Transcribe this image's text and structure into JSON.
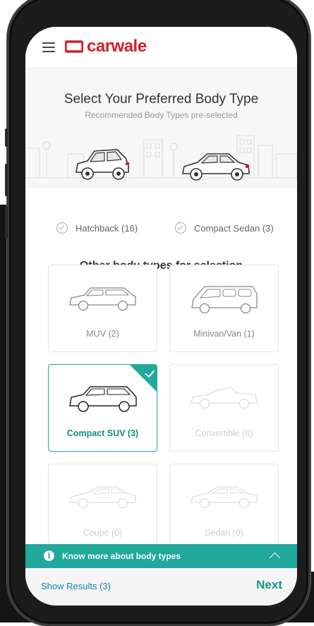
{
  "header": {
    "logo_text": "carwale"
  },
  "hero": {
    "title": "Select Your Preferred Body Type",
    "subtitle": "Recommended Body Types pre-selected"
  },
  "recommended": [
    {
      "label": "Hatchback (16)"
    },
    {
      "label": "Compact Sedan (3)"
    }
  ],
  "other": {
    "title": "Other body types for selection",
    "tiles": [
      {
        "label": "MUV (2)",
        "state": "normal"
      },
      {
        "label": "Minivan/Van (1)",
        "state": "normal"
      },
      {
        "label": "Compact SUV (3)",
        "state": "selected"
      },
      {
        "label": "Convertible (0)",
        "state": "disabled"
      },
      {
        "label": "Coupe (0)",
        "state": "disabled"
      },
      {
        "label": "Sedan (0)",
        "state": "disabled"
      }
    ]
  },
  "info_bar": {
    "icon": "i",
    "text": "Know more about body types"
  },
  "footer": {
    "show_results": "Show Results (3)",
    "next": "Next"
  },
  "colors": {
    "brand": "#d3202a",
    "accent": "#20a89b",
    "link": "#1a7fb5"
  }
}
